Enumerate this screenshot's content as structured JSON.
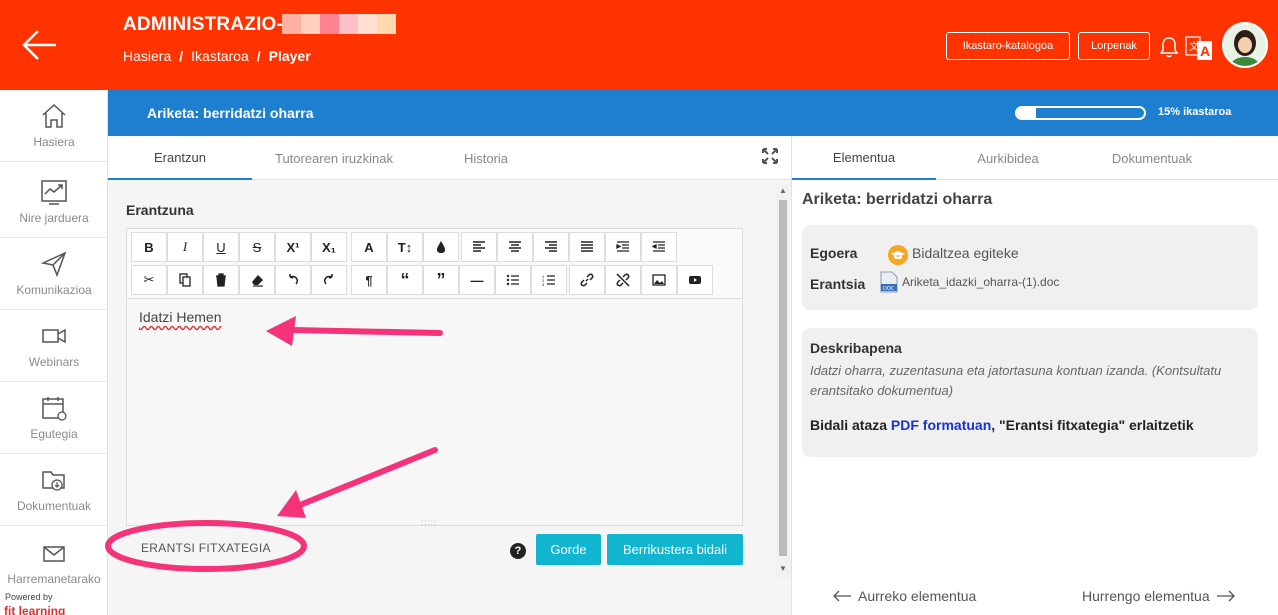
{
  "header": {
    "title": "ADMINISTRAZIO-",
    "title_blur_colors": [
      "#ffb0a0",
      "#ffd0c0",
      "#ff8090",
      "#ffc0c8",
      "#ffe0d0",
      "#ffd8b0"
    ],
    "breadcrumb": [
      "Hasiera",
      "Ikastaroa",
      "Player"
    ],
    "buttons": {
      "catalog": "Ikastaro-katalogoa",
      "achievements": "Lorpenak"
    },
    "accent": "#ff3300"
  },
  "sidebar": {
    "items": [
      {
        "label": "Hasiera",
        "icon": "home-icon"
      },
      {
        "label": "Nire jarduera",
        "icon": "activity-icon"
      },
      {
        "label": "Komunikazioa",
        "icon": "send-icon"
      },
      {
        "label": "Webinars",
        "icon": "video-icon"
      },
      {
        "label": "Egutegia",
        "icon": "calendar-icon"
      },
      {
        "label": "Dokumentuak",
        "icon": "folder-icon"
      },
      {
        "label": "Harremanetarako",
        "icon": "mail-icon"
      }
    ],
    "powered_by": "Powered by",
    "brand": "fit learning"
  },
  "bluebar": {
    "title": "Ariketa: berridatzi oharra",
    "progress_percent": 15,
    "progress_label": "15% ikastaroa",
    "color": "#1e7fd0"
  },
  "left": {
    "tabs": [
      "Erantzun",
      "Tutorearen iruzkinak",
      "Historia"
    ],
    "section_label": "Erantzuna",
    "editor_text": "Idatzi Hemen",
    "attach_label": "ERANTSI FITXATEGIA",
    "help": "?",
    "save_label": "Gorde",
    "submit_label": "Berrikustera bidali"
  },
  "right": {
    "tabs": [
      "Elementua",
      "Aurkibidea",
      "Dokumentuak"
    ],
    "title": "Ariketa: berridatzi oharra",
    "status_label": "Egoera",
    "status_value": "Bidaltzea egiteke",
    "attachment_label": "Erantsia",
    "attachment_file": "Ariketa_idazki_oharra-(1).doc",
    "description_title": "Deskribapena",
    "description_text": "Idatzi oharra, zuzentasuna eta jatortasuna kontuan izanda. (Kontsultatu erantsitako dokumentua)",
    "send_prefix": "Bidali ataza ",
    "send_link": "PDF formatuan",
    "send_suffix": ", \"Erantsi fitxategia\" erlaitzetik",
    "prev_label": "Aurreko elementua",
    "next_label": "Hurrengo elementua"
  }
}
